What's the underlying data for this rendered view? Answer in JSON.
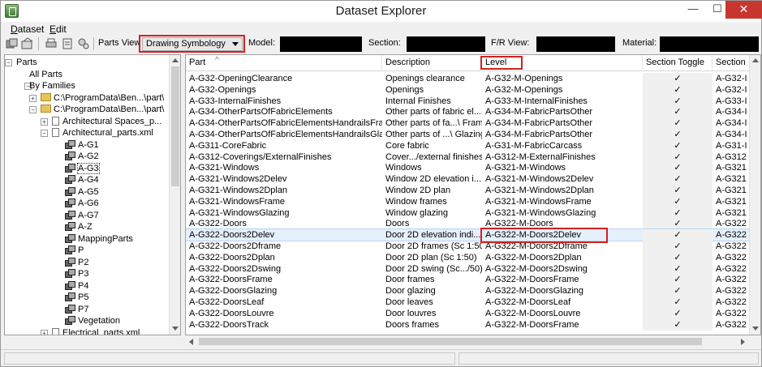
{
  "window": {
    "title": "Dataset Explorer",
    "minimize": "—",
    "maximize": "☐",
    "close": "✕"
  },
  "menu": [
    "Dataset",
    "Edit"
  ],
  "toolbar": {
    "parts_view_label": "Parts View",
    "parts_view_value": "Drawing Symbology",
    "model_label": "Model:",
    "section_label": "Section:",
    "fr_view_label": "F/R View:",
    "material_label": "Material:"
  },
  "tree": [
    {
      "label": "Parts",
      "level": 0,
      "icon": "none",
      "expander": "minus"
    },
    {
      "label": "All Parts",
      "level": 1,
      "icon": "none",
      "expander": "none"
    },
    {
      "label": "By Families",
      "level": 1,
      "icon": "none",
      "expander": "minus"
    },
    {
      "label": "C:\\ProgramData\\Ben...\\part\\",
      "level": 2,
      "icon": "folder",
      "expander": "plus"
    },
    {
      "label": "C:\\ProgramData\\Ben...\\part\\",
      "level": 2,
      "icon": "folder",
      "expander": "minus"
    },
    {
      "label": "Architectural Spaces_p...",
      "level": 3,
      "icon": "doc",
      "expander": "plus"
    },
    {
      "label": "Architectural_parts.xml",
      "level": 3,
      "icon": "doc",
      "expander": "minus"
    },
    {
      "label": "A-G1",
      "level": 4,
      "icon": "part",
      "expander": "none"
    },
    {
      "label": "A-G2",
      "level": 4,
      "icon": "part",
      "expander": "none"
    },
    {
      "label": "A-G3",
      "level": 4,
      "icon": "part",
      "expander": "none",
      "selected": true
    },
    {
      "label": "A-G4",
      "level": 4,
      "icon": "part",
      "expander": "none"
    },
    {
      "label": "A-G5",
      "level": 4,
      "icon": "part",
      "expander": "none"
    },
    {
      "label": "A-G6",
      "level": 4,
      "icon": "part",
      "expander": "none"
    },
    {
      "label": "A-G7",
      "level": 4,
      "icon": "part",
      "expander": "none"
    },
    {
      "label": "A-Z",
      "level": 4,
      "icon": "part",
      "expander": "none"
    },
    {
      "label": "MappingParts",
      "level": 4,
      "icon": "part",
      "expander": "none"
    },
    {
      "label": "P",
      "level": 4,
      "icon": "part",
      "expander": "none"
    },
    {
      "label": "P2",
      "level": 4,
      "icon": "part",
      "expander": "none"
    },
    {
      "label": "P3",
      "level": 4,
      "icon": "part",
      "expander": "none"
    },
    {
      "label": "P4",
      "level": 4,
      "icon": "part",
      "expander": "none"
    },
    {
      "label": "P5",
      "level": 4,
      "icon": "part",
      "expander": "none"
    },
    {
      "label": "P7",
      "level": 4,
      "icon": "part",
      "expander": "none"
    },
    {
      "label": "Vegetation",
      "level": 4,
      "icon": "part",
      "expander": "none"
    },
    {
      "label": "Electrical_parts.xml",
      "level": 3,
      "icon": "doc",
      "expander": "plus"
    }
  ],
  "grid": {
    "columns": [
      "Part",
      "Description",
      "Level",
      "Section Toggle",
      "Section"
    ],
    "sort_indicator": "^",
    "rows": [
      {
        "part": "A-G32-OpeningClearance",
        "description": "Openings clearance",
        "level": "A-G32-M-Openings",
        "toggle": "✓",
        "section": "A-G32-I"
      },
      {
        "part": "A-G32-Openings",
        "description": "Openings",
        "level": "A-G32-M-Openings",
        "toggle": "✓",
        "section": "A-G32-I"
      },
      {
        "part": "A-G33-InternalFinishes",
        "description": "Internal Finishes",
        "level": "A-G33-M-InternalFinishes",
        "toggle": "✓",
        "section": "A-G33-I"
      },
      {
        "part": "A-G34-OtherPartsOfFabricElements",
        "description": "Other parts of fabric el...",
        "level": "A-G34-M-FabricPartsOther",
        "toggle": "✓",
        "section": "A-G34-I"
      },
      {
        "part": "A-G34-OtherPartsOfFabricElementsHandrailsFrame",
        "description": "Other parts of fa...\\ Frame",
        "level": "A-G34-M-FabricPartsOther",
        "toggle": "✓",
        "section": "A-G34-I"
      },
      {
        "part": "A-G34-OtherPartsOfFabricElementsHandrailsGla...",
        "description": "Other parts of ...\\ Glazing",
        "level": "A-G34-M-FabricPartsOther",
        "toggle": "✓",
        "section": "A-G34-I"
      },
      {
        "part": "A-G311-CoreFabric",
        "description": "Core fabric",
        "level": "A-G31-M-FabricCarcass",
        "toggle": "✓",
        "section": "A-G31-I"
      },
      {
        "part": "A-G312-Coverings/ExternalFinishes",
        "description": "Cover.../external finishes",
        "level": "A-G312-M-ExternalFinishes",
        "toggle": "✓",
        "section": "A-G312"
      },
      {
        "part": "A-G321-Windows",
        "description": "Windows",
        "level": "A-G321-M-Windows",
        "toggle": "✓",
        "section": "A-G321"
      },
      {
        "part": "A-G321-Windows2Delev",
        "description": "Window 2D elevation i...",
        "level": "A-G321-M-Windows2Delev",
        "toggle": "✓",
        "section": "A-G321"
      },
      {
        "part": "A-G321-Windows2Dplan",
        "description": "Window 2D plan",
        "level": "A-G321-M-Windows2Dplan",
        "toggle": "✓",
        "section": "A-G321"
      },
      {
        "part": "A-G321-WindowsFrame",
        "description": "Window frames",
        "level": "A-G321-M-WindowsFrame",
        "toggle": "✓",
        "section": "A-G321"
      },
      {
        "part": "A-G321-WindowsGlazing",
        "description": "Window glazing",
        "level": "A-G321-M-WindowsGlazing",
        "toggle": "✓",
        "section": "A-G321"
      },
      {
        "part": "A-G322-Doors",
        "description": "Doors",
        "level": "A-G322-M-Doors",
        "toggle": "✓",
        "section": "A-G322"
      },
      {
        "part": "A-G322-Doors2Delev",
        "description": "Door 2D elevation indi...",
        "level": "A-G322-M-Doors2Delev",
        "toggle": "✓",
        "section": "A-G322",
        "selected": true
      },
      {
        "part": "A-G322-Doors2Dframe",
        "description": "Door 2D frames (Sc 1:50)",
        "level": "A-G322-M-Doors2Dframe",
        "toggle": "✓",
        "section": "A-G322"
      },
      {
        "part": "A-G322-Doors2Dplan",
        "description": "Door 2D plan (Sc 1:50)",
        "level": "A-G322-M-Doors2Dplan",
        "toggle": "✓",
        "section": "A-G322"
      },
      {
        "part": "A-G322-Doors2Dswing",
        "description": "Door 2D swing (Sc.../50)",
        "level": "A-G322-M-Doors2Dswing",
        "toggle": "✓",
        "section": "A-G322"
      },
      {
        "part": "A-G322-DoorsFrame",
        "description": "Door frames",
        "level": "A-G322-M-DoorsFrame",
        "toggle": "✓",
        "section": "A-G322"
      },
      {
        "part": "A-G322-DoorsGlazing",
        "description": "Door glazing",
        "level": "A-G322-M-DoorsGlazing",
        "toggle": "✓",
        "section": "A-G322"
      },
      {
        "part": "A-G322-DoorsLeaf",
        "description": "Door leaves",
        "level": "A-G322-M-DoorsLeaf",
        "toggle": "✓",
        "section": "A-G322"
      },
      {
        "part": "A-G322-DoorsLouvre",
        "description": "Door louvres",
        "level": "A-G322-M-DoorsLouvre",
        "toggle": "✓",
        "section": "A-G322"
      },
      {
        "part": "A-G322-DoorsTrack",
        "description": "Doors frames",
        "level": "A-G322-M-DoorsFrame",
        "toggle": "✓",
        "section": "A-G322"
      }
    ]
  },
  "colors": {
    "highlight": "#d32020",
    "selected_row": "#e6f0fb",
    "close_button": "#c7372f"
  }
}
